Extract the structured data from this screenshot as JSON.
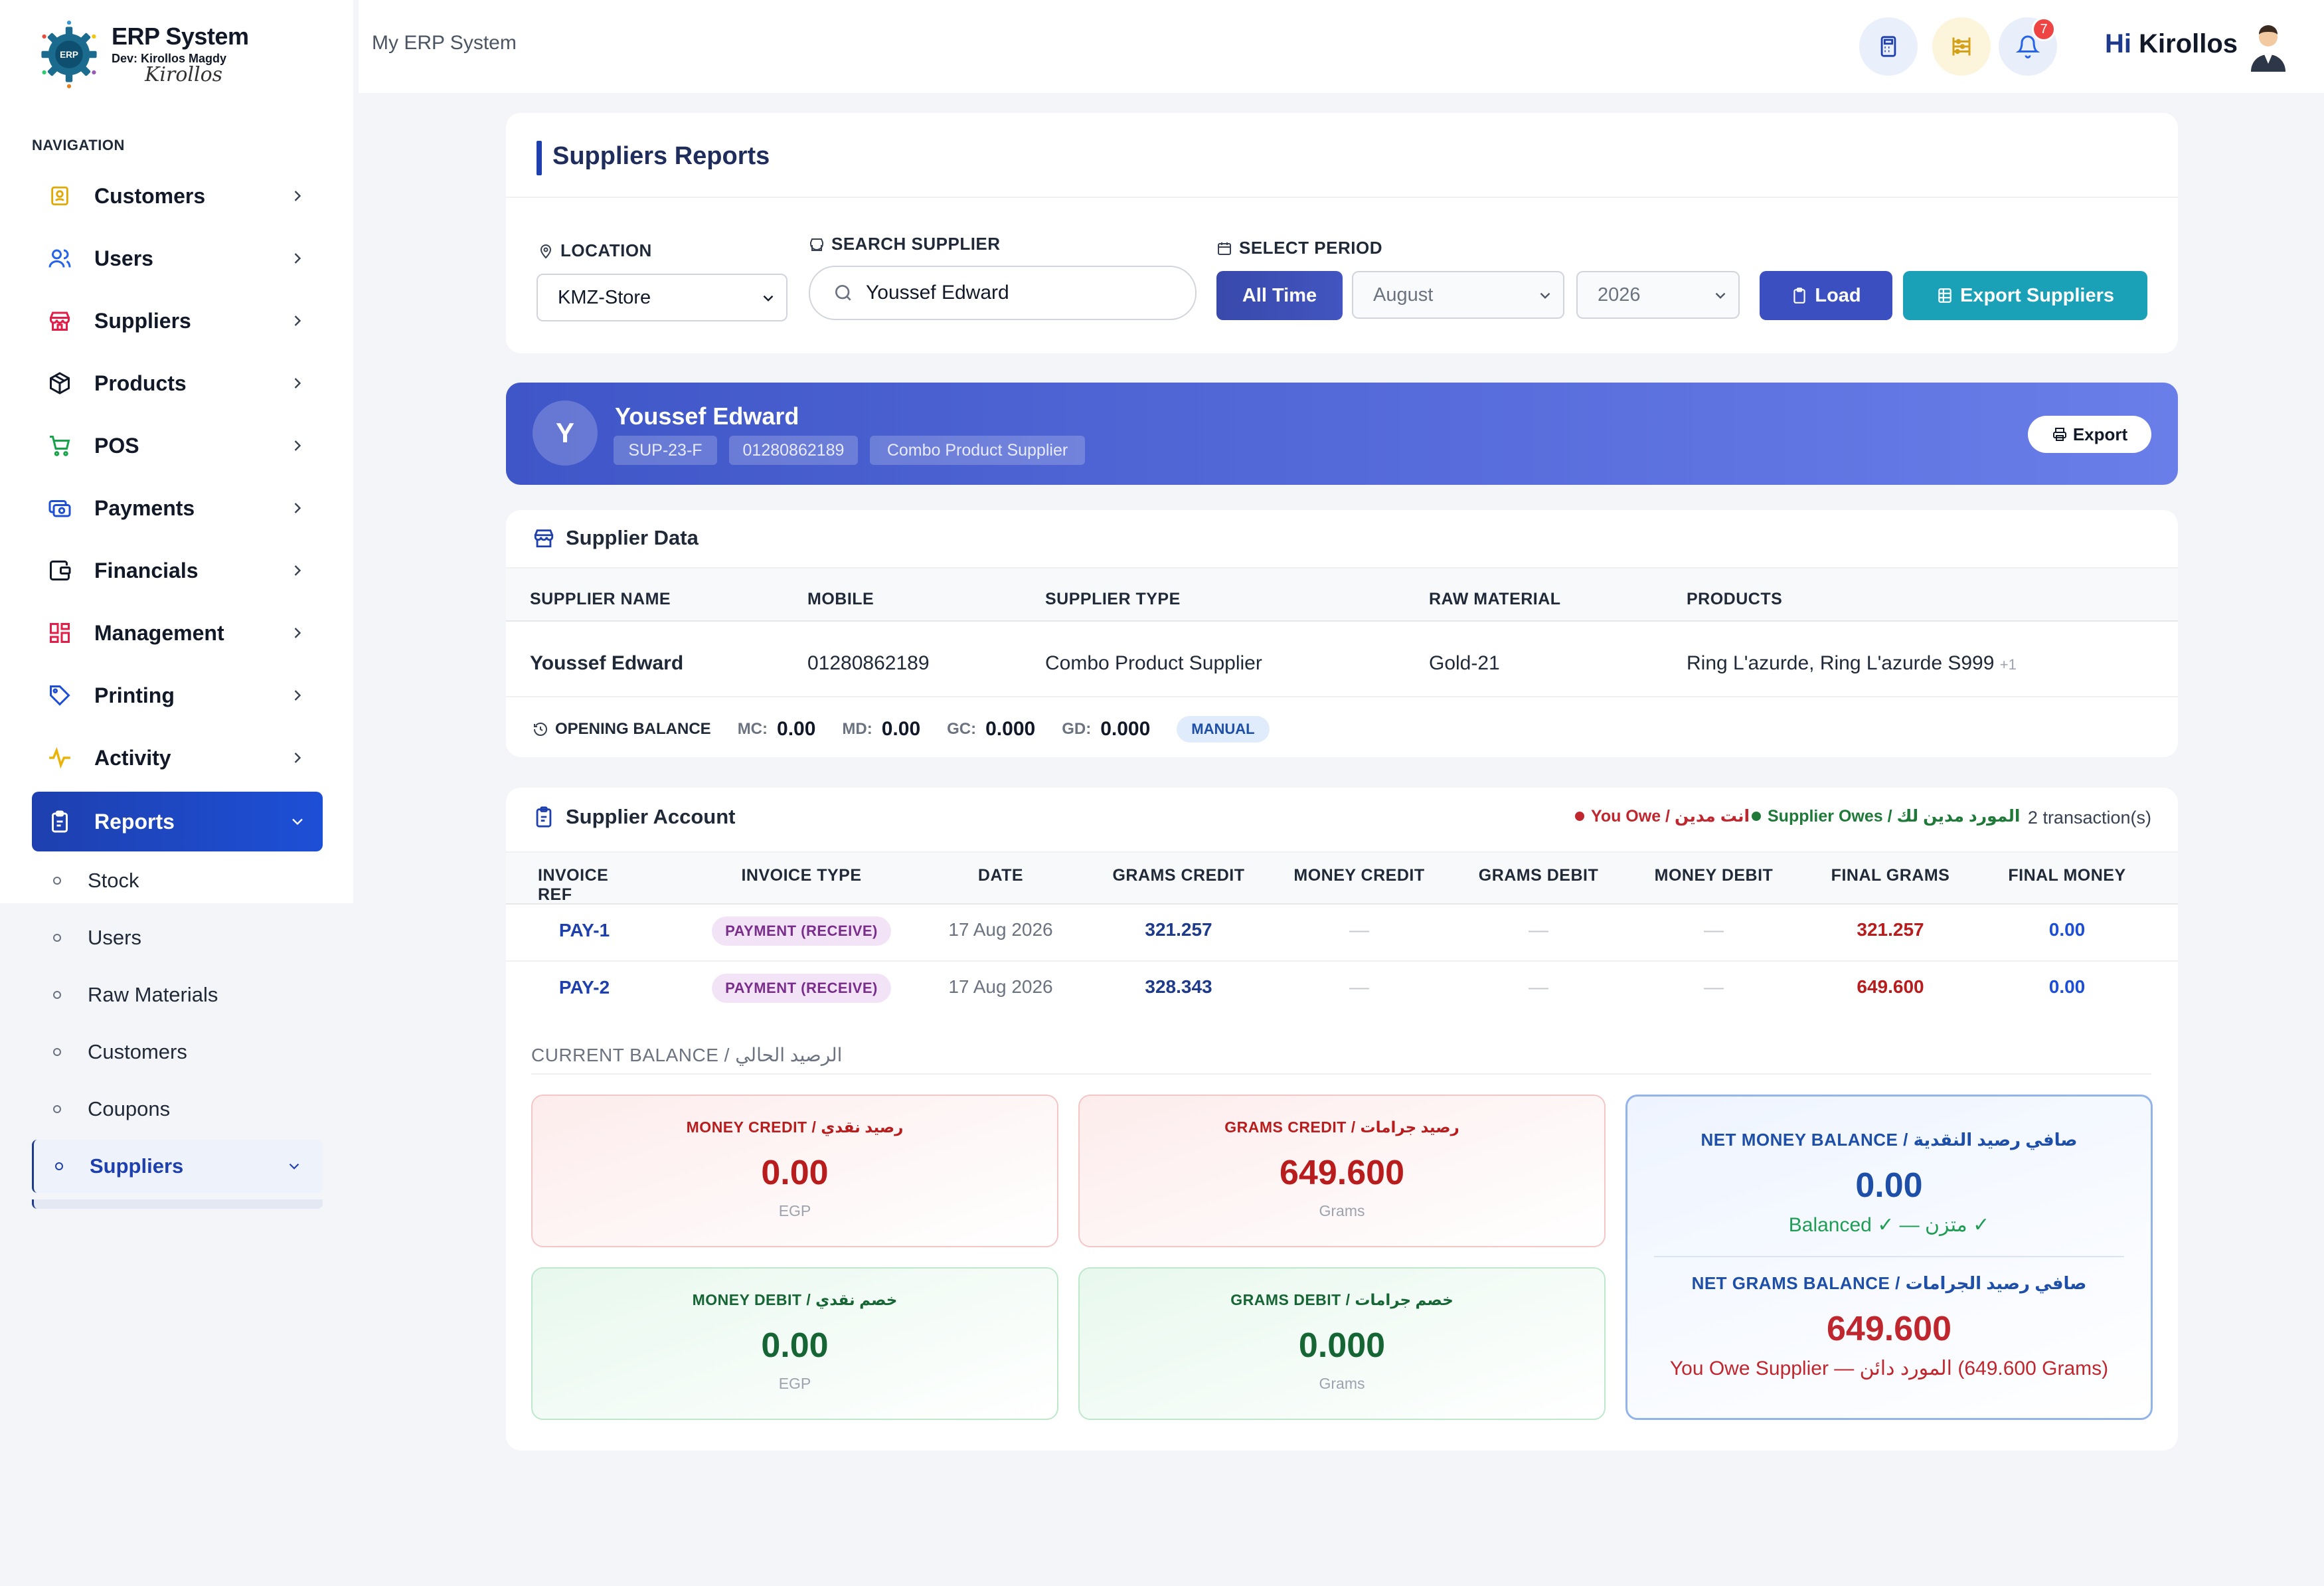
{
  "brand": {
    "title": "ERP System",
    "dev": "Dev: Kirollos Magdy",
    "signature": "Kirollos",
    "logo_text": "ERP"
  },
  "nav": {
    "heading": "NAVIGATION",
    "items": [
      {
        "label": "Customers",
        "icon": "customers-icon"
      },
      {
        "label": "Users",
        "icon": "users-icon"
      },
      {
        "label": "Suppliers",
        "icon": "store-icon"
      },
      {
        "label": "Products",
        "icon": "box-icon"
      },
      {
        "label": "POS",
        "icon": "cart-icon"
      },
      {
        "label": "Payments",
        "icon": "payments-icon"
      },
      {
        "label": "Financials",
        "icon": "wallet-icon"
      },
      {
        "label": "Management",
        "icon": "grid-icon"
      },
      {
        "label": "Printing",
        "icon": "tag-icon"
      },
      {
        "label": "Activity",
        "icon": "activity-icon"
      },
      {
        "label": "Reports",
        "icon": "clipboard-icon"
      }
    ],
    "report_subitems": [
      "Stock",
      "Users",
      "Raw Materials",
      "Customers",
      "Coupons",
      "Suppliers"
    ]
  },
  "topbar": {
    "title": "My ERP System",
    "notification_count": "7",
    "greeting_prefix": "Hi",
    "user_name": "Kirollos"
  },
  "filters": {
    "title": "Suppliers Reports",
    "location_label": "LOCATION",
    "location_value": "KMZ-Store",
    "search_label": "SEARCH SUPPLIER",
    "search_value": "Youssef Edward",
    "period_label": "SELECT PERIOD",
    "all_time": "All Time",
    "month": "August",
    "year": "2026",
    "load": "Load",
    "export_suppliers": "Export Suppliers"
  },
  "banner": {
    "initial": "Y",
    "name": "Youssef Edward",
    "code": "SUP-23-F",
    "mobile": "01280862189",
    "type": "Combo Product Supplier",
    "export": "Export"
  },
  "supplier_data": {
    "title": "Supplier Data",
    "headers": [
      "SUPPLIER NAME",
      "MOBILE",
      "SUPPLIER TYPE",
      "RAW MATERIAL",
      "PRODUCTS"
    ],
    "row": {
      "name": "Youssef Edward",
      "mobile": "01280862189",
      "type": "Combo Product Supplier",
      "raw": "Gold-21",
      "products": "Ring L'azurde, Ring L'azurde S999",
      "more": "+1"
    },
    "opening": {
      "label": "OPENING BALANCE",
      "mc_key": "MC:",
      "mc": "0.00",
      "md_key": "MD:",
      "md": "0.00",
      "gc_key": "GC:",
      "gc": "0.000",
      "gd_key": "GD:",
      "gd": "0.000",
      "badge": "MANUAL"
    }
  },
  "account": {
    "title": "Supplier Account",
    "legend_owe": "You Owe / انت مدين",
    "legend_owes": "Supplier Owes / المورد مدين لك",
    "tx_count": "2 transaction(s)",
    "headers": [
      "INVOICE REF",
      "INVOICE TYPE",
      "DATE",
      "GRAMS CREDIT",
      "MONEY CREDIT",
      "GRAMS DEBIT",
      "MONEY DEBIT",
      "FINAL GRAMS",
      "FINAL MONEY"
    ],
    "rows": [
      {
        "ref": "PAY-1",
        "type": "PAYMENT (RECEIVE)",
        "date": "17 Aug 2026",
        "grams_credit": "321.257",
        "money_credit": "—",
        "grams_debit": "—",
        "money_debit": "—",
        "final_grams": "321.257",
        "final_money": "0.00"
      },
      {
        "ref": "PAY-2",
        "type": "PAYMENT (RECEIVE)",
        "date": "17 Aug 2026",
        "grams_credit": "328.343",
        "money_credit": "—",
        "grams_debit": "—",
        "money_debit": "—",
        "final_grams": "649.600",
        "final_money": "0.00"
      }
    ],
    "balance_heading": "CURRENT BALANCE / الرصيد الحالي",
    "money_credit": {
      "label": "MONEY CREDIT / رصيد نقدي",
      "value": "0.00",
      "unit": "EGP"
    },
    "grams_credit": {
      "label": "GRAMS CREDIT / رصيد جرامات",
      "value": "649.600",
      "unit": "Grams"
    },
    "money_debit": {
      "label": "MONEY DEBIT / خصم نقدي",
      "value": "0.00",
      "unit": "EGP"
    },
    "grams_debit": {
      "label": "GRAMS DEBIT / خصم جرامات",
      "value": "0.000",
      "unit": "Grams"
    },
    "net_money": {
      "label": "NET MONEY BALANCE / صافي رصيد النقدية",
      "value": "0.00",
      "status": "Balanced ✓ — متزن ✓"
    },
    "net_grams": {
      "label": "NET GRAMS BALANCE / صافي رصيد الجرامات",
      "value": "649.600",
      "status": "You Owe Supplier — المورد دائن (649.600 Grams)"
    }
  }
}
